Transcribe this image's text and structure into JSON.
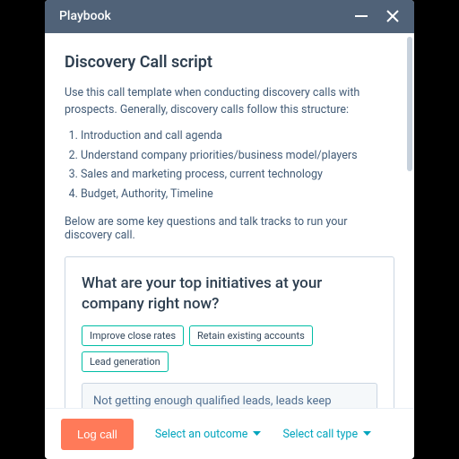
{
  "header": {
    "title": "Playbook"
  },
  "page": {
    "title": "Discovery Call script",
    "intro": "Use this call template when conducting discovery calls with prospects. Generally, discovery calls follow this structure:",
    "steps": [
      "Introduction and call agenda",
      "Understand company priorities/business model/players",
      "Sales and marketing process, current technology",
      "Budget, Authority, Timeline"
    ],
    "lead_out": "Below are some key questions and talk tracks to run your discovery call."
  },
  "question_card": {
    "question": "What are your top initiatives at your company right now?",
    "chips": [
      "Improve close rates",
      "Retain existing accounts",
      "Lead generation"
    ],
    "notes": "Not getting enough qualified leads, leads keep slipping through the cracks"
  },
  "footer": {
    "primary": "Log call",
    "outcome_label": "Select an outcome",
    "calltype_label": "Select call type"
  },
  "colors": {
    "accent": "#ff7a59",
    "link": "#00a4bd",
    "header_bg": "#506278",
    "chip_border": "#00bda5"
  }
}
